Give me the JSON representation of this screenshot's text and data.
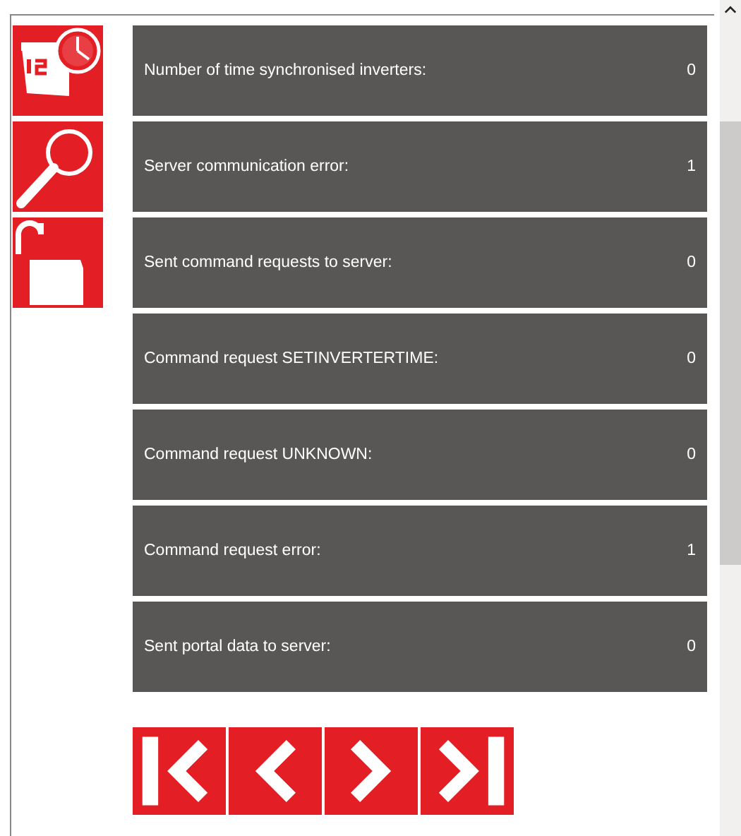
{
  "sidebar": {
    "items": [
      {
        "kind": "calendar"
      },
      {
        "kind": "search"
      },
      {
        "kind": "lock"
      }
    ]
  },
  "rows": [
    {
      "label": "Number of time synchronised inverters:",
      "value": "0"
    },
    {
      "label": "Server communication error:",
      "value": "1"
    },
    {
      "label": "Sent command requests to server:",
      "value": "0"
    },
    {
      "label": "Command request SETINVERTERTIME:",
      "value": "0"
    },
    {
      "label": "Command request UNKNOWN:",
      "value": "0"
    },
    {
      "label": "Command request error:",
      "value": "1"
    },
    {
      "label": "Sent portal data to server:",
      "value": "0"
    }
  ],
  "pager": [
    {
      "kind": "first"
    },
    {
      "kind": "prev"
    },
    {
      "kind": "next"
    },
    {
      "kind": "last"
    }
  ]
}
